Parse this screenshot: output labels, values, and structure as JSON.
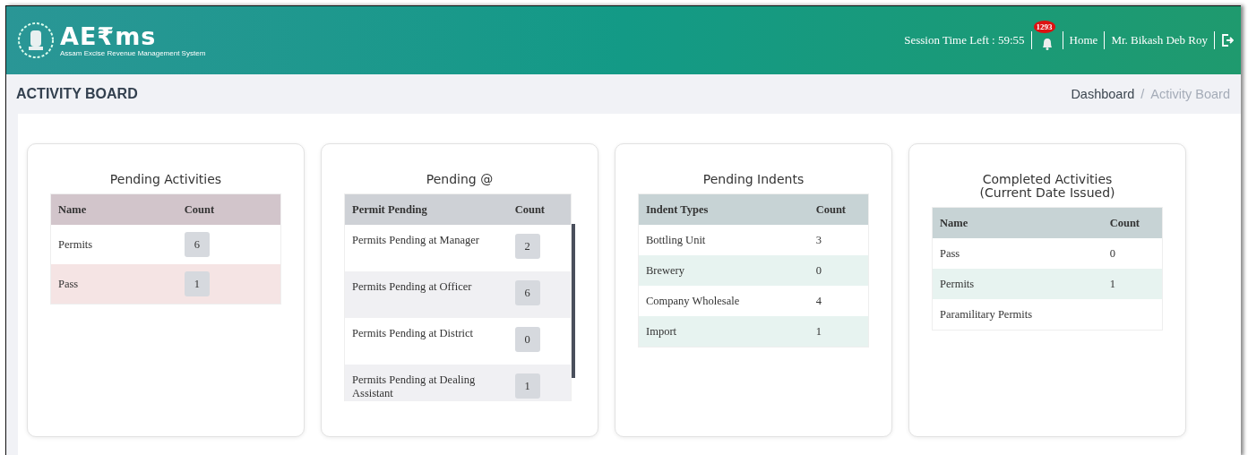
{
  "header": {
    "logo_text": "AE₹ms",
    "logo_subtitle": "Assam Excise Revenue Management System",
    "session": "Session Time Left : 59:55",
    "notification_count": "1293",
    "nav": [
      "Home",
      "Mr. Bikash Deb Roy"
    ]
  },
  "page_title": "ACTIVITY BOARD",
  "breadcrumb_separator": "/",
  "breadcrumb": [
    {
      "label": "Dashboard",
      "current": false
    },
    {
      "label": "Activity Board",
      "current": true
    }
  ],
  "cards": [
    {
      "title": "Pending Activities",
      "kind": "badge",
      "columns": [
        "Name",
        "Count"
      ],
      "rows": [
        [
          "Permits",
          "6"
        ],
        [
          "Pass",
          "1"
        ]
      ]
    },
    {
      "title": "Pending @",
      "kind": "badge",
      "columns": [
        "Permit Pending",
        "Count"
      ],
      "rows": [
        [
          "Permits Pending at Manager",
          "2"
        ],
        [
          "Permits Pending at Officer",
          "6"
        ],
        [
          "Permits Pending at District",
          "0"
        ],
        [
          "Permits Pending at Dealing Assistant",
          "1"
        ]
      ]
    },
    {
      "title": "Pending Indents",
      "kind": "plain",
      "columns": [
        "Indent Types",
        "Count"
      ],
      "rows": [
        [
          "Bottling Unit",
          "3"
        ],
        [
          "Brewery",
          "0"
        ],
        [
          "Company Wholesale",
          "4"
        ],
        [
          "Import",
          "1"
        ]
      ]
    },
    {
      "title": "Completed Activities\n(Current Date Issued)",
      "kind": "plain",
      "columns": [
        "Name",
        "Count"
      ],
      "rows": [
        [
          "Pass",
          "0"
        ],
        [
          "Permits",
          "1"
        ],
        [
          "Paramilitary Permits"
        ]
      ]
    }
  ]
}
